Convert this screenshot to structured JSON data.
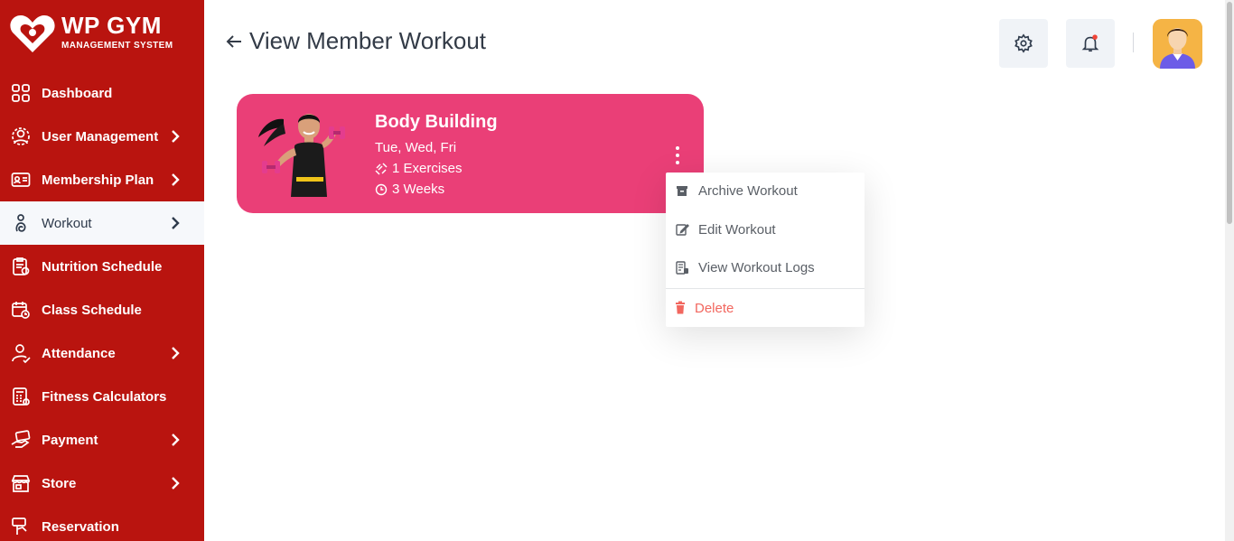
{
  "brand": {
    "title": "WP GYM",
    "subtitle": "MANAGEMENT SYSTEM",
    "accent": "#b9140f"
  },
  "sidebar": {
    "items": [
      {
        "label": "Dashboard",
        "icon": "grid-icon",
        "has_submenu": false
      },
      {
        "label": "User Management",
        "icon": "users-gear-icon",
        "has_submenu": true
      },
      {
        "label": "Membership Plan",
        "icon": "id-card-icon",
        "has_submenu": true
      },
      {
        "label": "Workout",
        "icon": "workout-icon",
        "has_submenu": true,
        "active": true
      },
      {
        "label": "Nutrition Schedule",
        "icon": "clipboard-icon",
        "has_submenu": false
      },
      {
        "label": "Class Schedule",
        "icon": "calendar-icon",
        "has_submenu": false
      },
      {
        "label": "Attendance",
        "icon": "user-check-icon",
        "has_submenu": true
      },
      {
        "label": "Fitness Calculators",
        "icon": "calculator-icon",
        "has_submenu": false
      },
      {
        "label": "Payment",
        "icon": "payment-icon",
        "has_submenu": true
      },
      {
        "label": "Store",
        "icon": "store-icon",
        "has_submenu": true
      },
      {
        "label": "Reservation",
        "icon": "reservation-icon",
        "has_submenu": false
      }
    ]
  },
  "header": {
    "title": "View Member Workout",
    "settings_icon": "gear-icon",
    "notification_icon": "bell-icon",
    "notification_dot_color": "#f04438",
    "avatar_bg": "#f5b445"
  },
  "workout_card": {
    "title": "Body Building",
    "days": "Tue, Wed, Fri",
    "exercises": "1 Exercises",
    "duration": "3 Weeks",
    "card_color": "#ea3f77"
  },
  "menu": {
    "items": [
      {
        "label": "Archive Workout",
        "icon": "archive-icon"
      },
      {
        "label": "Edit Workout",
        "icon": "edit-icon"
      },
      {
        "label": "View Workout Logs",
        "icon": "logs-icon"
      },
      {
        "label": "Delete",
        "icon": "trash-icon",
        "danger": true
      }
    ]
  }
}
